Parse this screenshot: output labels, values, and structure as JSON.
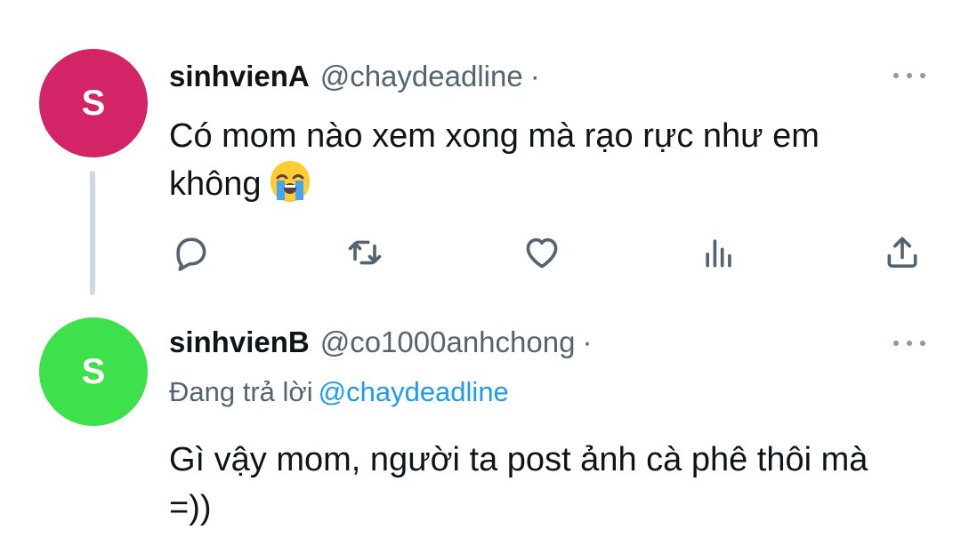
{
  "thread": {
    "tweets": [
      {
        "avatar_letter": "S",
        "avatar_color": "#d42468",
        "display_name": "sinhvienA",
        "handle": "@chaydeadline",
        "separator": "·",
        "text": "Có mom nào xem xong mà rạo rực như em không",
        "emoji": "loudly-crying-face",
        "actions": [
          "reply-icon",
          "retweet-icon",
          "like-icon",
          "views-icon",
          "share-icon"
        ]
      },
      {
        "avatar_letter": "S",
        "avatar_color": "#3ee04c",
        "display_name": "sinhvienB",
        "handle": "@co1000anhchong",
        "separator": "·",
        "replying_label": "Đang trả lời",
        "replying_to": "@chaydeadline",
        "text": "Gì vậy mom, người ta post ảnh cà phê thôi mà =))"
      }
    ]
  },
  "colors": {
    "text": "#0f1419",
    "secondary": "#536471",
    "link": "#1d9bf0",
    "thread_line": "#cfd9de"
  }
}
